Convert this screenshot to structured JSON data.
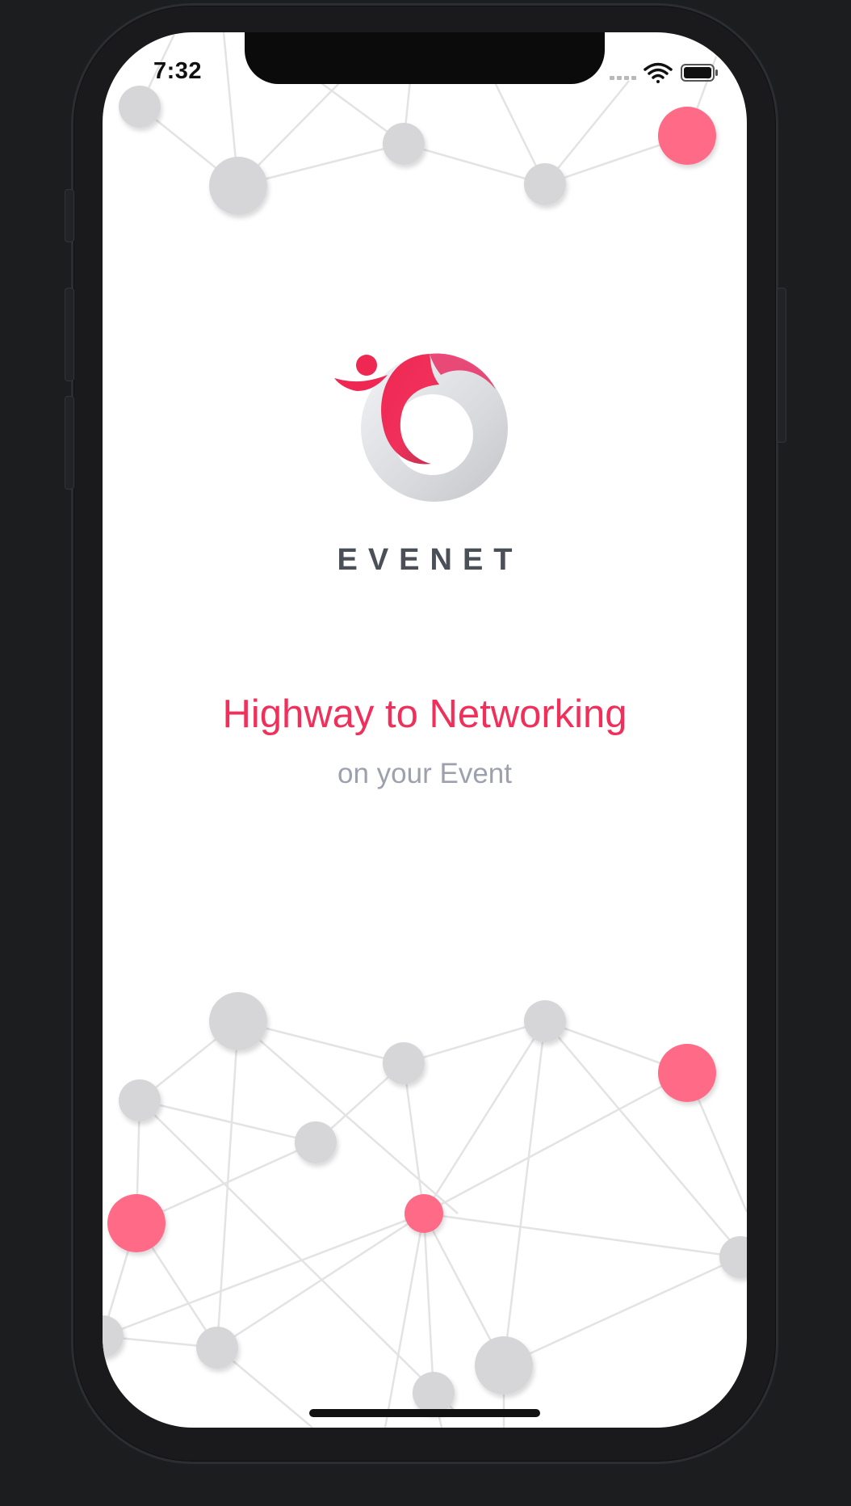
{
  "status_bar": {
    "time": "7:32",
    "signal_icon": "signal-dots-icon",
    "wifi_icon": "wifi-icon",
    "battery_icon": "battery-icon"
  },
  "brand": {
    "name": "EVENET",
    "logo_icon": "evenet-logo-icon"
  },
  "hero": {
    "tagline": "Highway to Networking",
    "subtitle": "on your Event"
  },
  "colors": {
    "accent": "#f0305a",
    "node_accent": "#ff6b87",
    "node_neutral": "#d6d6d8",
    "brand_text": "#4a4f58",
    "subtitle_text": "#9da1ad"
  }
}
